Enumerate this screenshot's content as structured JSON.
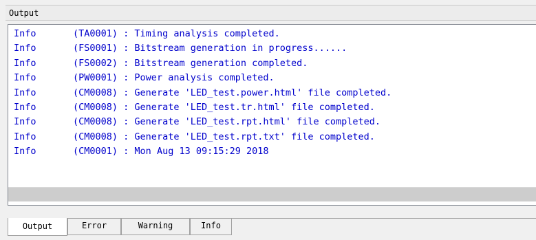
{
  "panel": {
    "title": "Output"
  },
  "log": [
    {
      "level": "Info",
      "code": "(TA0001)",
      "message": ": Timing analysis completed."
    },
    {
      "level": "Info",
      "code": "(FS0001)",
      "message": ": Bitstream generation in progress......"
    },
    {
      "level": "Info",
      "code": "(FS0002)",
      "message": ": Bitstream generation completed."
    },
    {
      "level": "Info",
      "code": "(PW0001)",
      "message": ": Power analysis completed."
    },
    {
      "level": "Info",
      "code": "(CM0008)",
      "message": ": Generate 'LED_test.power.html' file completed."
    },
    {
      "level": "Info",
      "code": "(CM0008)",
      "message": ": Generate 'LED_test.tr.html' file completed."
    },
    {
      "level": "Info",
      "code": "(CM0008)",
      "message": ": Generate 'LED_test.rpt.html' file completed."
    },
    {
      "level": "Info",
      "code": "(CM0008)",
      "message": ": Generate 'LED_test.rpt.txt' file completed."
    },
    {
      "level": "Info",
      "code": "(CM0001)",
      "message": ": Mon Aug 13 09:15:29 2018"
    }
  ],
  "tabs": [
    {
      "label": "Output",
      "active": true
    },
    {
      "label": "Error",
      "active": false
    },
    {
      "label": "Warning",
      "active": false
    },
    {
      "label": "Info",
      "active": false
    }
  ],
  "colors": {
    "log_text": "#0000cc",
    "panel_bg": "#f0f0f0",
    "output_bg": "#ffffff",
    "scrollbar": "#cdcdcd"
  }
}
